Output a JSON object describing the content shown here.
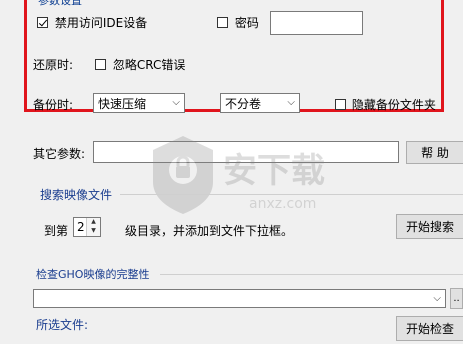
{
  "params_group": {
    "title": "参数设置",
    "disable_ide_label": "禁用访问IDE设备",
    "disable_ide_checked": true,
    "password_label": "密码",
    "password_checked": false,
    "password_value": "",
    "restore_label": "还原时:",
    "ignore_crc_label": "忽略CRC错误",
    "ignore_crc_checked": false,
    "backup_label": "备份时:",
    "compression_value": "快速压缩",
    "split_value": "不分卷",
    "hide_backup_label": "隐藏备份文件夹",
    "hide_backup_checked": false
  },
  "other_params": {
    "label": "其它参数:",
    "value": "",
    "help_button": "帮  助"
  },
  "search_group": {
    "title": "搜索映像文件",
    "prefix": "到第",
    "level_value": "2",
    "suffix": "级目录，并添加到文件下拉框。",
    "start_button": "开始搜索"
  },
  "check_group": {
    "title": "检查GHO映像的完整性",
    "file_select_value": "",
    "browse_button": "..",
    "selected_file_label": "所选文件:",
    "start_button": "开始检查"
  },
  "watermark": {
    "text": "安下载",
    "subtext": "anxz.com"
  },
  "colors": {
    "highlight_border": "#e0141c",
    "group_title": "#1a3d8f"
  }
}
